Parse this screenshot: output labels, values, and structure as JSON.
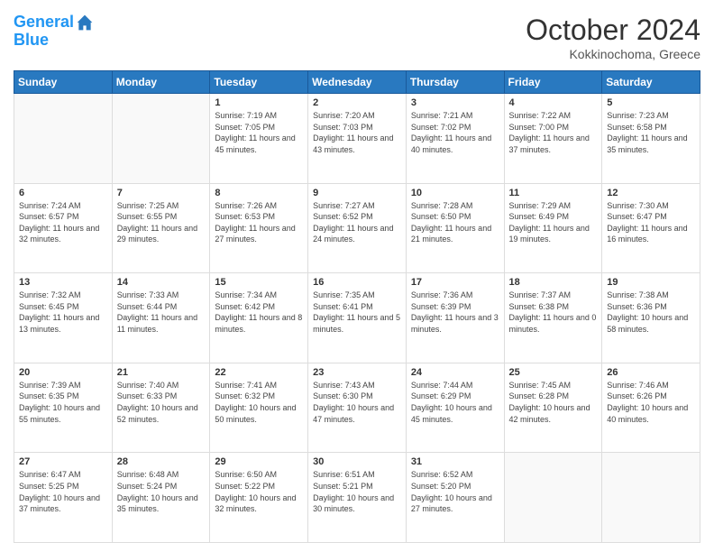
{
  "header": {
    "logo_line1": "General",
    "logo_line2": "Blue",
    "month": "October 2024",
    "location": "Kokkinochoma, Greece"
  },
  "weekdays": [
    "Sunday",
    "Monday",
    "Tuesday",
    "Wednesday",
    "Thursday",
    "Friday",
    "Saturday"
  ],
  "weeks": [
    [
      {
        "day": "",
        "sunrise": "",
        "sunset": "",
        "daylight": ""
      },
      {
        "day": "",
        "sunrise": "",
        "sunset": "",
        "daylight": ""
      },
      {
        "day": "1",
        "sunrise": "Sunrise: 7:19 AM",
        "sunset": "Sunset: 7:05 PM",
        "daylight": "Daylight: 11 hours and 45 minutes."
      },
      {
        "day": "2",
        "sunrise": "Sunrise: 7:20 AM",
        "sunset": "Sunset: 7:03 PM",
        "daylight": "Daylight: 11 hours and 43 minutes."
      },
      {
        "day": "3",
        "sunrise": "Sunrise: 7:21 AM",
        "sunset": "Sunset: 7:02 PM",
        "daylight": "Daylight: 11 hours and 40 minutes."
      },
      {
        "day": "4",
        "sunrise": "Sunrise: 7:22 AM",
        "sunset": "Sunset: 7:00 PM",
        "daylight": "Daylight: 11 hours and 37 minutes."
      },
      {
        "day": "5",
        "sunrise": "Sunrise: 7:23 AM",
        "sunset": "Sunset: 6:58 PM",
        "daylight": "Daylight: 11 hours and 35 minutes."
      }
    ],
    [
      {
        "day": "6",
        "sunrise": "Sunrise: 7:24 AM",
        "sunset": "Sunset: 6:57 PM",
        "daylight": "Daylight: 11 hours and 32 minutes."
      },
      {
        "day": "7",
        "sunrise": "Sunrise: 7:25 AM",
        "sunset": "Sunset: 6:55 PM",
        "daylight": "Daylight: 11 hours and 29 minutes."
      },
      {
        "day": "8",
        "sunrise": "Sunrise: 7:26 AM",
        "sunset": "Sunset: 6:53 PM",
        "daylight": "Daylight: 11 hours and 27 minutes."
      },
      {
        "day": "9",
        "sunrise": "Sunrise: 7:27 AM",
        "sunset": "Sunset: 6:52 PM",
        "daylight": "Daylight: 11 hours and 24 minutes."
      },
      {
        "day": "10",
        "sunrise": "Sunrise: 7:28 AM",
        "sunset": "Sunset: 6:50 PM",
        "daylight": "Daylight: 11 hours and 21 minutes."
      },
      {
        "day": "11",
        "sunrise": "Sunrise: 7:29 AM",
        "sunset": "Sunset: 6:49 PM",
        "daylight": "Daylight: 11 hours and 19 minutes."
      },
      {
        "day": "12",
        "sunrise": "Sunrise: 7:30 AM",
        "sunset": "Sunset: 6:47 PM",
        "daylight": "Daylight: 11 hours and 16 minutes."
      }
    ],
    [
      {
        "day": "13",
        "sunrise": "Sunrise: 7:32 AM",
        "sunset": "Sunset: 6:45 PM",
        "daylight": "Daylight: 11 hours and 13 minutes."
      },
      {
        "day": "14",
        "sunrise": "Sunrise: 7:33 AM",
        "sunset": "Sunset: 6:44 PM",
        "daylight": "Daylight: 11 hours and 11 minutes."
      },
      {
        "day": "15",
        "sunrise": "Sunrise: 7:34 AM",
        "sunset": "Sunset: 6:42 PM",
        "daylight": "Daylight: 11 hours and 8 minutes."
      },
      {
        "day": "16",
        "sunrise": "Sunrise: 7:35 AM",
        "sunset": "Sunset: 6:41 PM",
        "daylight": "Daylight: 11 hours and 5 minutes."
      },
      {
        "day": "17",
        "sunrise": "Sunrise: 7:36 AM",
        "sunset": "Sunset: 6:39 PM",
        "daylight": "Daylight: 11 hours and 3 minutes."
      },
      {
        "day": "18",
        "sunrise": "Sunrise: 7:37 AM",
        "sunset": "Sunset: 6:38 PM",
        "daylight": "Daylight: 11 hours and 0 minutes."
      },
      {
        "day": "19",
        "sunrise": "Sunrise: 7:38 AM",
        "sunset": "Sunset: 6:36 PM",
        "daylight": "Daylight: 10 hours and 58 minutes."
      }
    ],
    [
      {
        "day": "20",
        "sunrise": "Sunrise: 7:39 AM",
        "sunset": "Sunset: 6:35 PM",
        "daylight": "Daylight: 10 hours and 55 minutes."
      },
      {
        "day": "21",
        "sunrise": "Sunrise: 7:40 AM",
        "sunset": "Sunset: 6:33 PM",
        "daylight": "Daylight: 10 hours and 52 minutes."
      },
      {
        "day": "22",
        "sunrise": "Sunrise: 7:41 AM",
        "sunset": "Sunset: 6:32 PM",
        "daylight": "Daylight: 10 hours and 50 minutes."
      },
      {
        "day": "23",
        "sunrise": "Sunrise: 7:43 AM",
        "sunset": "Sunset: 6:30 PM",
        "daylight": "Daylight: 10 hours and 47 minutes."
      },
      {
        "day": "24",
        "sunrise": "Sunrise: 7:44 AM",
        "sunset": "Sunset: 6:29 PM",
        "daylight": "Daylight: 10 hours and 45 minutes."
      },
      {
        "day": "25",
        "sunrise": "Sunrise: 7:45 AM",
        "sunset": "Sunset: 6:28 PM",
        "daylight": "Daylight: 10 hours and 42 minutes."
      },
      {
        "day": "26",
        "sunrise": "Sunrise: 7:46 AM",
        "sunset": "Sunset: 6:26 PM",
        "daylight": "Daylight: 10 hours and 40 minutes."
      }
    ],
    [
      {
        "day": "27",
        "sunrise": "Sunrise: 6:47 AM",
        "sunset": "Sunset: 5:25 PM",
        "daylight": "Daylight: 10 hours and 37 minutes."
      },
      {
        "day": "28",
        "sunrise": "Sunrise: 6:48 AM",
        "sunset": "Sunset: 5:24 PM",
        "daylight": "Daylight: 10 hours and 35 minutes."
      },
      {
        "day": "29",
        "sunrise": "Sunrise: 6:50 AM",
        "sunset": "Sunset: 5:22 PM",
        "daylight": "Daylight: 10 hours and 32 minutes."
      },
      {
        "day": "30",
        "sunrise": "Sunrise: 6:51 AM",
        "sunset": "Sunset: 5:21 PM",
        "daylight": "Daylight: 10 hours and 30 minutes."
      },
      {
        "day": "31",
        "sunrise": "Sunrise: 6:52 AM",
        "sunset": "Sunset: 5:20 PM",
        "daylight": "Daylight: 10 hours and 27 minutes."
      },
      {
        "day": "",
        "sunrise": "",
        "sunset": "",
        "daylight": ""
      },
      {
        "day": "",
        "sunrise": "",
        "sunset": "",
        "daylight": ""
      }
    ]
  ]
}
